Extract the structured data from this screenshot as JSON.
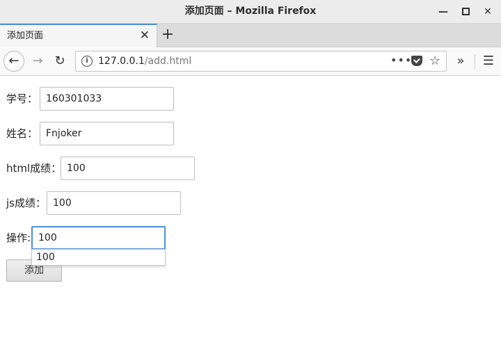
{
  "window": {
    "title": "添加页面  –  Mozilla Firefox",
    "min_glyph": "—",
    "close_glyph": "✕"
  },
  "tab": {
    "label": "添加页面",
    "close_glyph": "✕",
    "new_tab_glyph": "+"
  },
  "nav": {
    "back_glyph": "←",
    "forward_glyph": "→",
    "reload_glyph": "↻",
    "info_glyph": "i",
    "url_host": "127.0.0.1",
    "url_path": "/add.html",
    "more_glyph": "•••",
    "star_glyph": "☆",
    "overflow_glyph": "»",
    "menu_glyph": "☰"
  },
  "form": {
    "fields": [
      {
        "label": "学号：",
        "value": "160301033"
      },
      {
        "label": "姓名：",
        "value": "Fnjoker"
      },
      {
        "label": "html成绩：",
        "value": "100"
      },
      {
        "label": "js成绩：",
        "value": "100"
      },
      {
        "label": "操作:",
        "value": "100"
      }
    ],
    "suggestion": "100",
    "submit_label": "添加"
  }
}
